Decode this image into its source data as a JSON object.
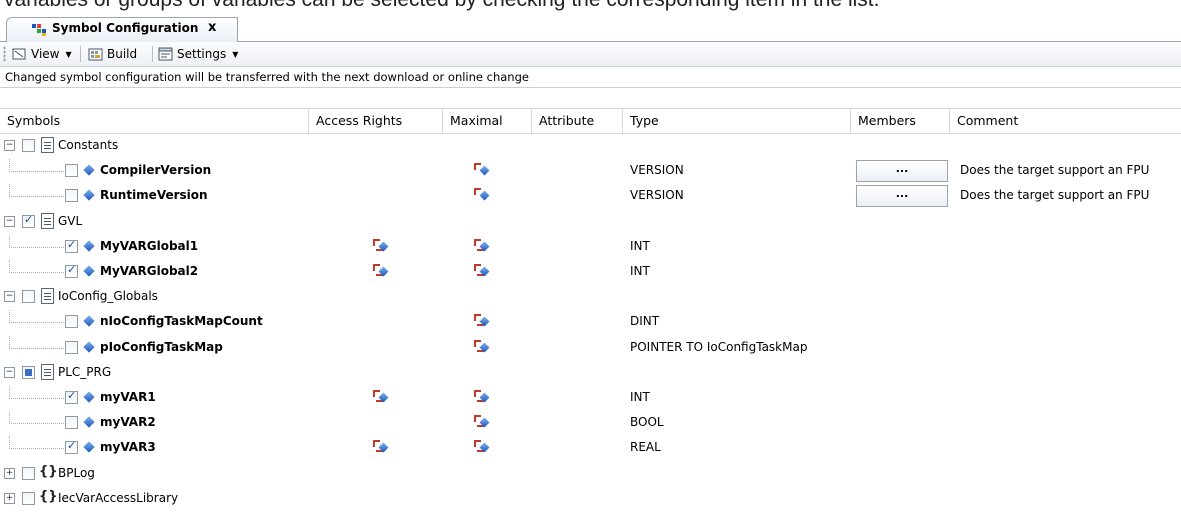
{
  "caption": "variables or groups of variables can be selected by checking the corresponding item in the list.",
  "tab": {
    "title": "Symbol Configuration",
    "close": "x"
  },
  "toolbar": {
    "view": "View",
    "build": "Build",
    "settings": "Settings"
  },
  "info": "Changed symbol configuration will be transferred with the next download or online change",
  "columns": {
    "symbols": "Symbols",
    "access": "Access Rights",
    "maximal": "Maximal",
    "attribute": "Attribute",
    "type": "Type",
    "members": "Members",
    "comment": "Comment"
  },
  "rows": [
    {
      "kind": "group",
      "icon": "doc",
      "label": "Constants",
      "check": "unchecked",
      "expanded": true
    },
    {
      "kind": "var",
      "label": "CompilerVersion",
      "check": "unchecked",
      "access": "",
      "maximal": "read",
      "type": "VERSION",
      "members": "...",
      "comment": "Does the target support an FPU"
    },
    {
      "kind": "var",
      "label": "RuntimeVersion",
      "check": "unchecked",
      "access": "",
      "maximal": "read",
      "type": "VERSION",
      "members": "...",
      "comment": "Does the target support an FPU"
    },
    {
      "kind": "group",
      "icon": "doc",
      "label": "GVL",
      "check": "checked",
      "expanded": true
    },
    {
      "kind": "var",
      "label": "MyVARGlobal1",
      "check": "checked",
      "access": "readwrite",
      "maximal": "readwrite",
      "type": "INT",
      "members": "",
      "comment": ""
    },
    {
      "kind": "var",
      "label": "MyVARGlobal2",
      "check": "checked",
      "access": "readwrite",
      "maximal": "readwrite",
      "type": "INT",
      "members": "",
      "comment": ""
    },
    {
      "kind": "group",
      "icon": "doc",
      "label": "IoConfig_Globals",
      "check": "unchecked",
      "expanded": true
    },
    {
      "kind": "var",
      "label": "nIoConfigTaskMapCount",
      "check": "unchecked",
      "access": "",
      "maximal": "readwrite",
      "type": "DINT",
      "members": "",
      "comment": ""
    },
    {
      "kind": "var",
      "label": "pIoConfigTaskMap",
      "check": "unchecked",
      "access": "",
      "maximal": "readwrite",
      "type": "POINTER TO IoConfigTaskMap",
      "members": "",
      "comment": ""
    },
    {
      "kind": "group",
      "icon": "doc",
      "label": "PLC_PRG",
      "check": "partial",
      "expanded": true
    },
    {
      "kind": "var",
      "label": "myVAR1",
      "check": "checked",
      "access": "readwrite",
      "maximal": "readwrite",
      "type": "INT",
      "members": "",
      "comment": ""
    },
    {
      "kind": "var",
      "label": "myVAR2",
      "check": "unchecked",
      "access": "",
      "maximal": "readwrite",
      "type": "BOOL",
      "members": "",
      "comment": ""
    },
    {
      "kind": "var",
      "label": "myVAR3",
      "check": "checked",
      "access": "readwrite",
      "maximal": "readwrite",
      "type": "REAL",
      "members": "",
      "comment": ""
    },
    {
      "kind": "group",
      "icon": "braces",
      "label": "BPLog",
      "check": "unchecked",
      "expanded": false
    },
    {
      "kind": "group",
      "icon": "braces",
      "label": "IecVarAccessLibrary",
      "check": "unchecked",
      "expanded": false
    }
  ]
}
